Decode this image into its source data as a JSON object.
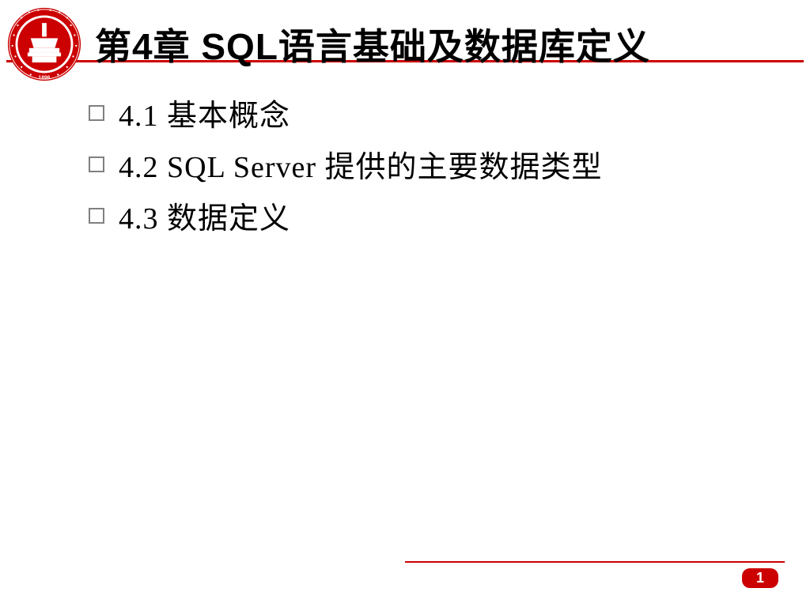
{
  "header": {
    "title": "第4章 SQL语言基础及数据库定义",
    "accent_color": "#cc0000"
  },
  "toc": {
    "items": [
      {
        "text": "4.1 基本概念"
      },
      {
        "text": "4.2 SQL Server 提供的主要数据类型"
      },
      {
        "text": "4.3 数据定义"
      }
    ]
  },
  "footer": {
    "page_number": "1"
  }
}
